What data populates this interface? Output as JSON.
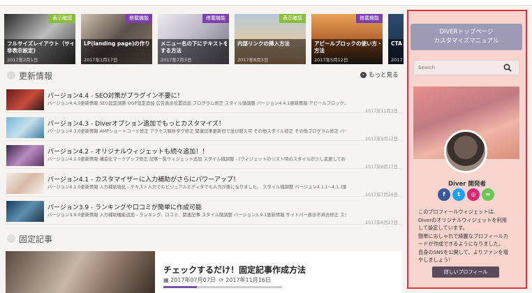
{
  "carousel": [
    {
      "badge": "表示確認",
      "badge_color": "#8bbd3b",
      "line1": "フルサイズレイアウト（サイドバー",
      "line2": "非表示設定)",
      "date": "2017年2月1日",
      "bg": "linear-gradient(135deg,#2b2b2b,#bdbdbd 50%,#3d3d3d)"
    },
    {
      "badge": "搭載機能",
      "badge_color": "#7d3fb0",
      "line1": "LP(landing page)の作り方",
      "line2": "",
      "date": "2017年1月17日",
      "bg": "linear-gradient(135deg,#d2c2b0,#5b5148 50%,#8a7a6c)"
    },
    {
      "badge": "搭載機能",
      "badge_color": "#7d3fb0",
      "line1": "メニュー名の下にテキストを追加",
      "line2": "する方法",
      "date": "2017年7月3日",
      "bg": "linear-gradient(135deg,#ece9ed,#b9b6c4 50%,#6f6c7a)"
    },
    {
      "badge": "表示確認",
      "badge_color": "#8bbd3b",
      "line1": "内部リンクの挿入方法",
      "line2": "",
      "date": "2017年8月3日",
      "bg": "linear-gradient(180deg,#b6c9d8,#e0c9a8 55%,#c99b6d)"
    },
    {
      "badge": "搭載機能",
      "badge_color": "#7d3fb0",
      "line1": "アピールブロックの使い方・表示",
      "line2": "方法",
      "date": "2017年5月12日",
      "bg": "linear-gradient(180deg,#e8a35a,#b3622a 55%,#3c2a22)"
    },
    {
      "badge": "",
      "badge_color": "#7d3fb0",
      "line1": "CTA",
      "line2": "",
      "date": "2017",
      "bg": "linear-gradient(180deg,#2c4a6e,#1a2d42)"
    }
  ],
  "news_section": {
    "title": "更新情報",
    "more": "もっと見る"
  },
  "news": [
    {
      "title": "バージョン4.4 - SEO対策がプラグイン不要に！",
      "desc": "バージョン4.4.0更新情報 SEO設定調整 OGP設定追加 広告表示位置追加 プログラム修正 スタイル微調整 バージョン4.4.1更新情報 アピールブロック...",
      "date": "2017年11月3日",
      "thumb": "linear-gradient(135deg,#6b1d1d,#c84b3c 55%,#2a1a1a)"
    },
    {
      "title": "バージョン4.3 - Diverオプション追加でもっとカスタマイズ！",
      "desc": "バージョン4.3.0更新情報 AMPショートコード修正 アクセス解析タグ修正 関連記事更新日で並び替え可 その他スタイル修正 その他プログラム修正 バージョン4...",
      "date": "2017年9月12日",
      "thumb": "linear-gradient(135deg,#74b6d6,#c6e0ea 50%,#3f7fa6)"
    },
    {
      "title": "バージョン4.2 - オリジナルウィジェットも続々追加！！",
      "desc": "バージョン4.2.0更新情報 構造化マークアップ修正 記事一覧ウィジェット追加 スタイル微調整 - (ウィジェットのリスト時のスタイルが少し変更しております。)...",
      "date": "2017年8月17日",
      "thumb": "linear-gradient(135deg,#3b2548,#b78cbf 50%,#5a3a63)"
    },
    {
      "title": "バージョン4.1 - カスタマイザーに入力補助がさらにパワーアップ！",
      "desc": "バージョン4.1.0更新情報 入力補助強化 - テキスト入力でもビジュアルエディタでも入力が楽になりました。 スタイル微調整 バージョン4.1.1~4.1.3更...",
      "date": "2017年7月28日",
      "thumb": "linear-gradient(135deg,#f3ece6,#d8b9a5 50%,#f6f2ee)"
    },
    {
      "title": "バージョン3.9 - ランキングや口コミが簡単に作成可能",
      "desc": "バージョン3.9.0更新情報 入力補助機能追加 - ランキング、口コミ、関連記事 スタイル微調整 バージョン3.9.1更新情報 サイドバー表示不具合修正 スタイ...",
      "date": "2017年6月27日",
      "thumb": "linear-gradient(135deg,#1b3e5e,#5d8fb0 50%,#20354a)"
    }
  ],
  "pinned_section": {
    "title": "固定記事"
  },
  "pinned": {
    "title": "チェックするだけ！固定記事作成方法",
    "published": "2017年07月07日",
    "updated": "2017年11月16日"
  },
  "sidebar": {
    "manual_button_line1": "DIVERトップページ",
    "manual_button_line2": "カスタマイズマニュアル",
    "search_placeholder": "Search",
    "profile_name": "Diver 開発者",
    "profile_lines": [
      "このプロフィールウィジェットは、",
      "Diverのオリジナルウィジェットを利用",
      "して設定しています。",
      "簡単におしゃれで綺麗なプロフィールカ",
      "ードが作成できるようになりました。",
      "自身のSNSを公開して、よりファンを増",
      "やしましょう！"
    ],
    "detail_button": "詳しいプロフィール",
    "socials": [
      {
        "name": "facebook-icon",
        "glyph": "f",
        "color": "#3b5998"
      },
      {
        "name": "twitter-icon",
        "glyph": "t",
        "color": "#1da1f2"
      },
      {
        "name": "instagram-icon",
        "glyph": "◎",
        "color": "#d62976"
      },
      {
        "name": "feedly-icon",
        "glyph": "➦",
        "color": "#6cc655"
      }
    ]
  }
}
